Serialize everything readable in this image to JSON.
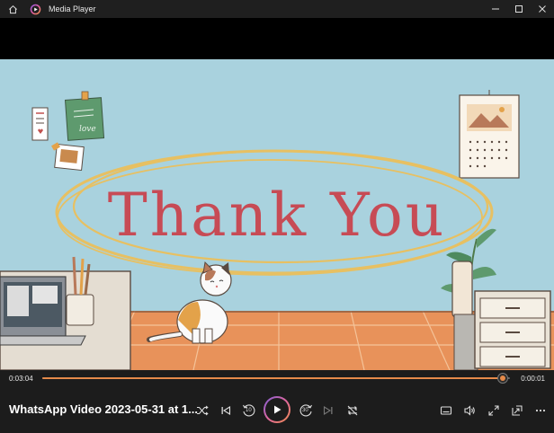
{
  "window": {
    "title": "Media Player"
  },
  "player": {
    "time_elapsed": "0:03:04",
    "time_remaining": "0:00:01",
    "progress": 0.985,
    "media_title": "WhatsApp Video 2023-05-31 at 1...",
    "skip_back_label": "10",
    "skip_forward_label": "30"
  },
  "video": {
    "caption": "Thank You"
  },
  "colors": {
    "accent": "#e58a4a",
    "titlebar": "#1f1f1f",
    "controls_bg": "#1c1c1c"
  }
}
